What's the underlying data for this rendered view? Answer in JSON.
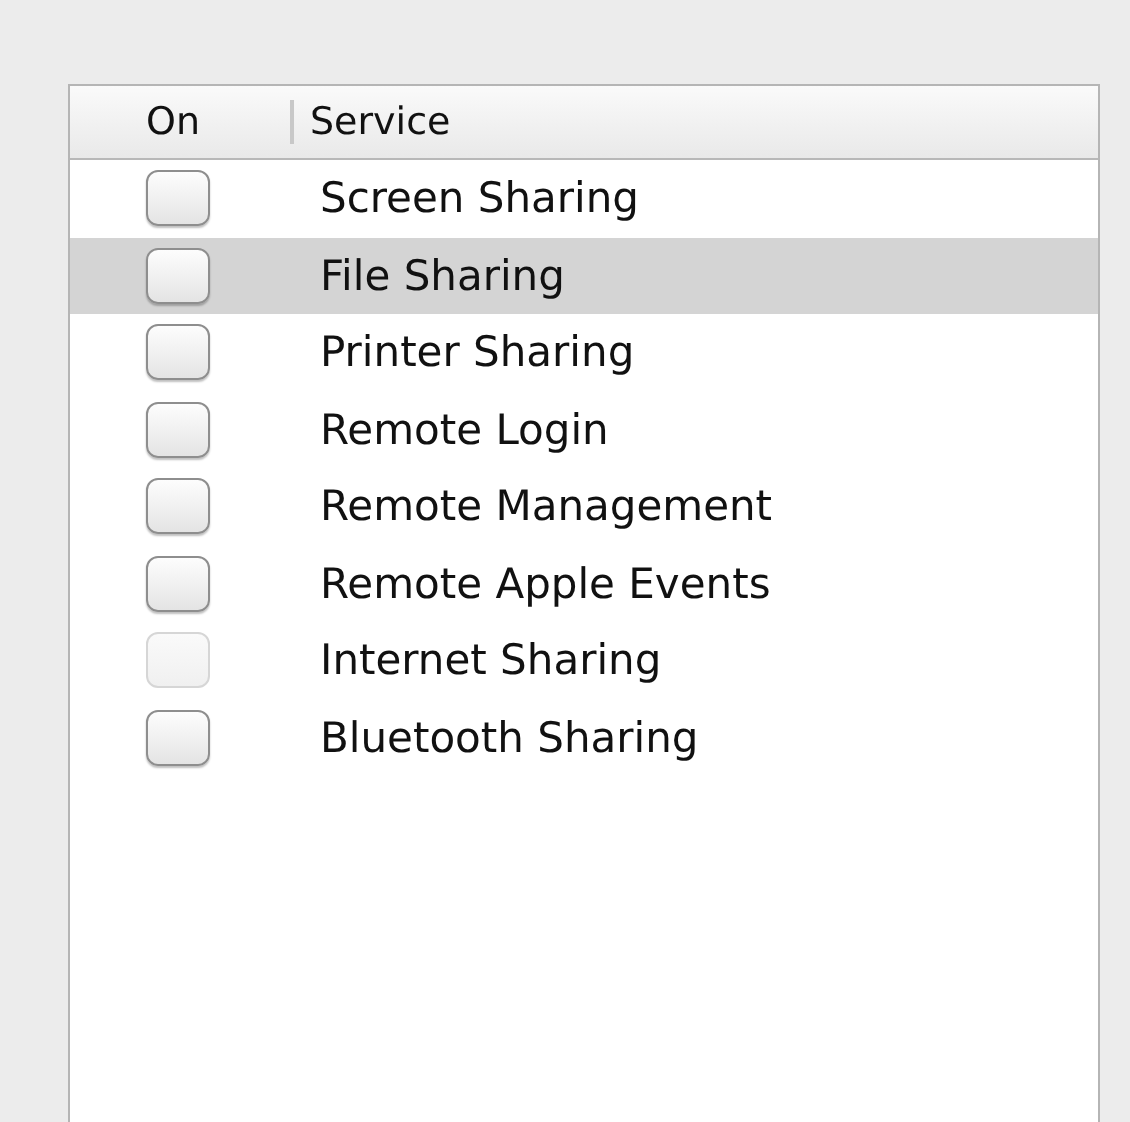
{
  "table": {
    "columns": [
      "On",
      "Service"
    ],
    "rows": [
      {
        "service": "Screen Sharing",
        "checked": false,
        "selected": false,
        "disabled": false
      },
      {
        "service": "File Sharing",
        "checked": false,
        "selected": true,
        "disabled": false
      },
      {
        "service": "Printer Sharing",
        "checked": false,
        "selected": false,
        "disabled": false
      },
      {
        "service": "Remote Login",
        "checked": false,
        "selected": false,
        "disabled": false
      },
      {
        "service": "Remote Management",
        "checked": false,
        "selected": false,
        "disabled": false
      },
      {
        "service": "Remote Apple Events",
        "checked": false,
        "selected": false,
        "disabled": false
      },
      {
        "service": "Internet Sharing",
        "checked": false,
        "selected": false,
        "disabled": true
      },
      {
        "service": "Bluetooth Sharing",
        "checked": false,
        "selected": false,
        "disabled": false
      }
    ]
  }
}
